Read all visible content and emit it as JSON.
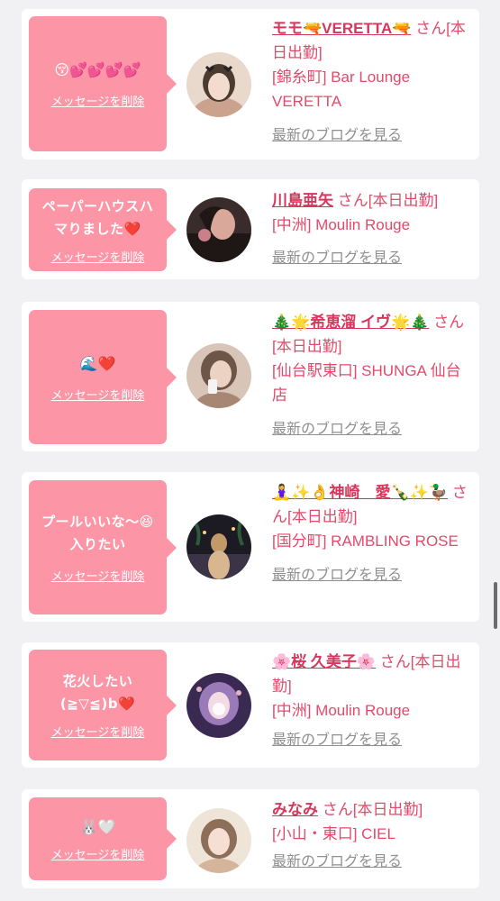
{
  "entries": [
    {
      "message": "😚💕💕💕💕",
      "emoji_only": true,
      "delete_label": "メッセージを削除",
      "name": "モモ🔫VERETTA🔫",
      "suffix": "さん[本日出勤]",
      "shop": "[錦糸町] Bar Lounge VERETTA",
      "blog_label": "最新のブログを見る",
      "avatar_colors": [
        "#e9d8cc",
        "#caa28e",
        "#4a3a30"
      ]
    },
    {
      "message": "ペーパーハウスハマりました❤️",
      "emoji_only": false,
      "delete_label": "メッセージを削除",
      "name": "川島亜矢",
      "suffix": "さん[本日出勤]",
      "shop": "[中洲] Moulin Rouge",
      "blog_label": "最新のブログを見る",
      "avatar_colors": [
        "#3a2c2a",
        "#c9808a",
        "#1e1716"
      ]
    },
    {
      "message": "🌊❤️",
      "emoji_only": true,
      "delete_label": "メッセージを削除",
      "name": "🎄🌟希恵溜 イヴ🌟🎄",
      "suffix": "さん[本日出勤]",
      "shop": "[仙台駅東口] SHUNGA 仙台店",
      "blog_label": "最新のブログを見る",
      "avatar_colors": [
        "#d9c5b8",
        "#a88674",
        "#6d5547"
      ]
    },
    {
      "message": "プールいいな〜😆入りたい",
      "emoji_only": false,
      "delete_label": "メッセージを削除",
      "name": "🧘‍♀️✨👌神崎　愛🍾✨🦆",
      "suffix": "さん[本日出勤]",
      "shop": "[国分町] RAMBLING ROSE",
      "blog_label": "最新のブログを見る",
      "avatar_colors": [
        "#1c1a22",
        "#c29a6a",
        "#3b3446"
      ]
    },
    {
      "message": "花火したい (≧▽≦)b❤️",
      "emoji_only": false,
      "delete_label": "メッセージを削除",
      "name": "🌸桜 久美子🌸",
      "suffix": "さん[本日出勤]",
      "shop": "[中洲] Moulin Rouge",
      "blog_label": "最新のブログを見る",
      "avatar_colors": [
        "#3a2a52",
        "#e3b3c8",
        "#9a7ab8"
      ]
    },
    {
      "message": "🐰🤍",
      "emoji_only": true,
      "delete_label": "メッセージを削除",
      "name": "みなみ",
      "suffix": "さん[本日出勤]",
      "shop": "[小山・東口] CIEL",
      "blog_label": "最新のブログを見る",
      "avatar_colors": [
        "#efe4d8",
        "#d4b49a",
        "#8d6e58"
      ]
    }
  ],
  "colors": {
    "bubble": "#fc96a7",
    "name": "#d6375d",
    "text": "#e24a6b",
    "link_gray": "#8f8f8f",
    "background": "#f1f1f3"
  }
}
